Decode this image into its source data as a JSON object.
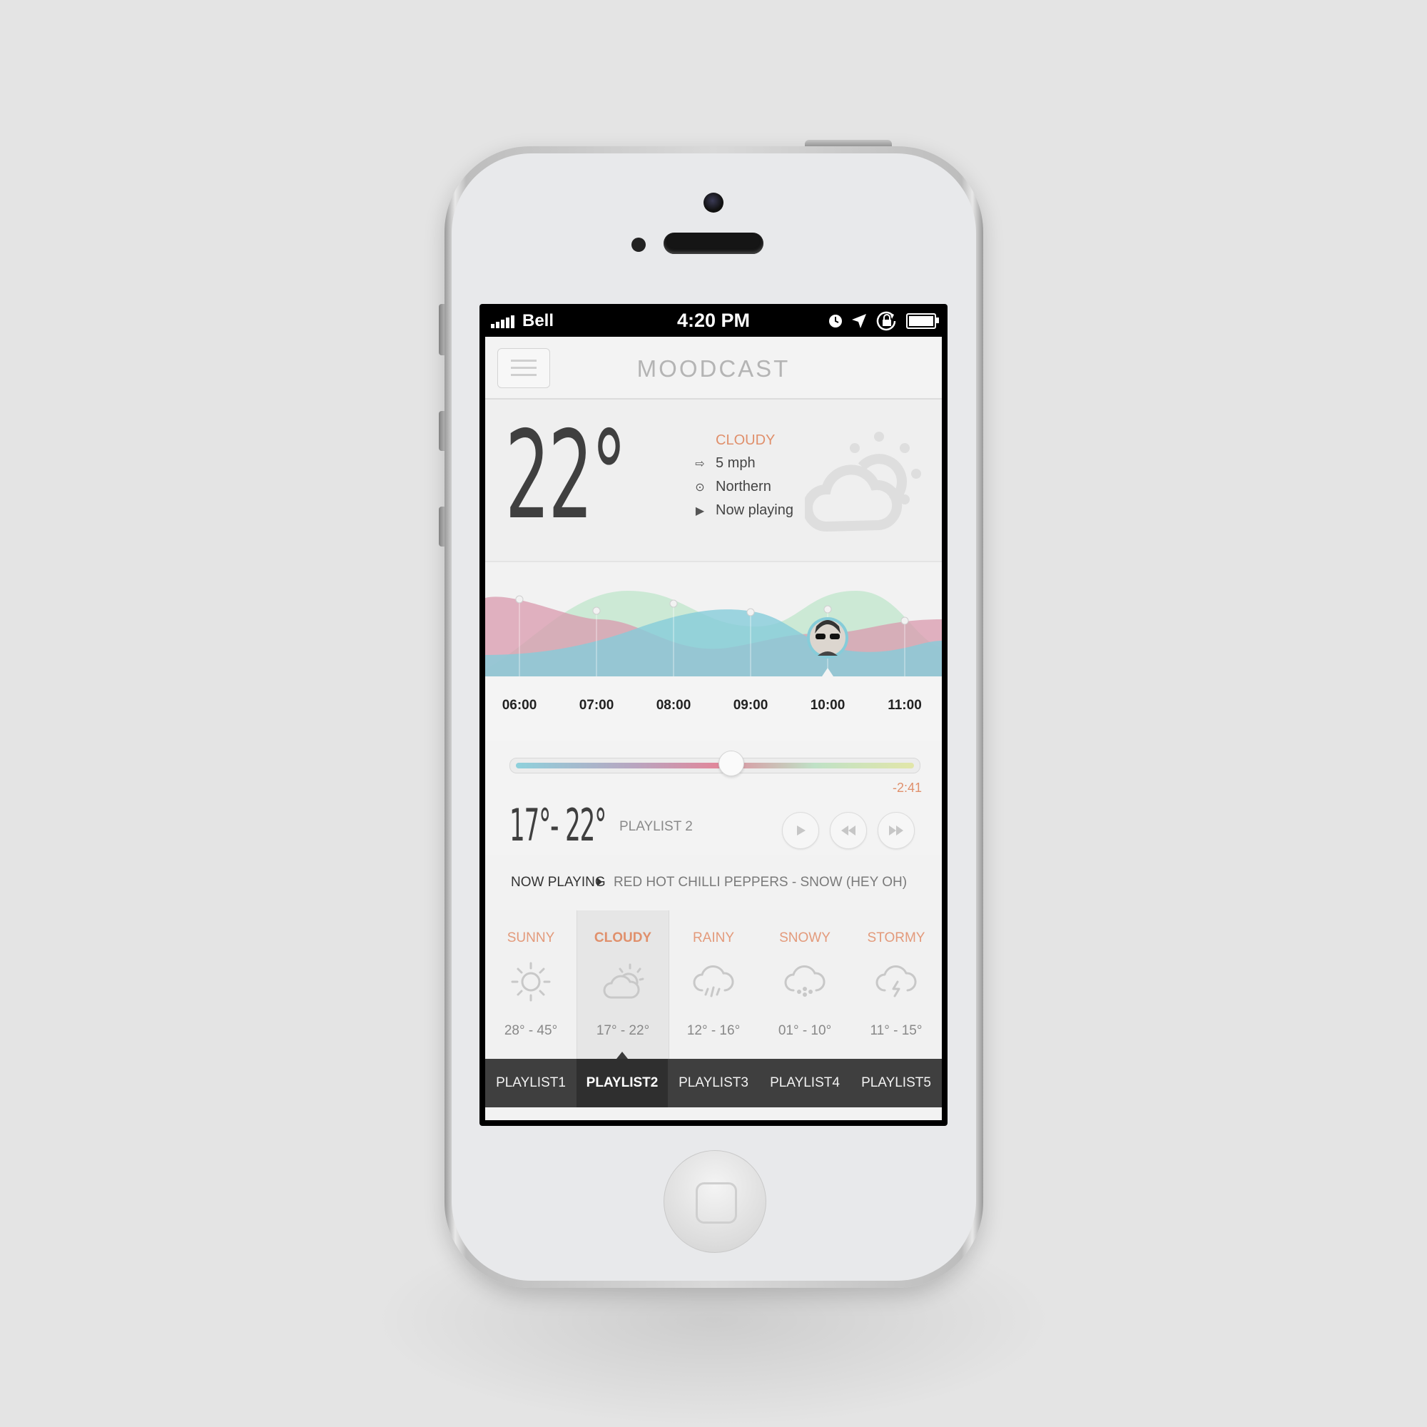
{
  "status_bar": {
    "carrier": "Bell",
    "time": "4:20 PM"
  },
  "app": {
    "title": "MOODCAST"
  },
  "current": {
    "temperature": "22°",
    "condition": "CLOUDY",
    "wind": "5 mph",
    "direction": "Northern",
    "status": "Now playing",
    "icon": "partly-cloudy-icon"
  },
  "timeline": {
    "ticks": [
      "06:00",
      "07:00",
      "08:00",
      "09:00",
      "10:00",
      "11:00"
    ],
    "marker_time": "10:00",
    "colors": {
      "pink": "#d99aae",
      "green": "#bfe6cb",
      "blue": "#86ccd9"
    }
  },
  "player": {
    "progress": 0.54,
    "remaining": "-2:41",
    "range": "17°- 22°",
    "playlist": "PLAYLIST 2",
    "controls": {
      "play": "play-icon",
      "rewind": "rewind-icon",
      "forward": "fast-forward-icon"
    }
  },
  "now_playing": {
    "label": "NOW PLAYING",
    "track": "RED HOT CHILLI PEPPERS - SNOW (HEY OH)"
  },
  "moods": [
    {
      "name": "SUNNY",
      "range": "28° - 45°",
      "icon": "sun-icon"
    },
    {
      "name": "CLOUDY",
      "range": "17° - 22°",
      "icon": "partly-cloudy-icon",
      "active": true
    },
    {
      "name": "RAINY",
      "range": "12° - 16°",
      "icon": "rain-icon"
    },
    {
      "name": "SNOWY",
      "range": "01° - 10°",
      "icon": "snow-icon"
    },
    {
      "name": "STORMY",
      "range": "11° - 15°",
      "icon": "storm-icon"
    }
  ],
  "tabs": [
    "PLAYLIST1",
    "PLAYLIST2",
    "PLAYLIST3",
    "PLAYLIST4",
    "PLAYLIST5"
  ],
  "active_tab": 1,
  "accent_color": "#e0906c"
}
